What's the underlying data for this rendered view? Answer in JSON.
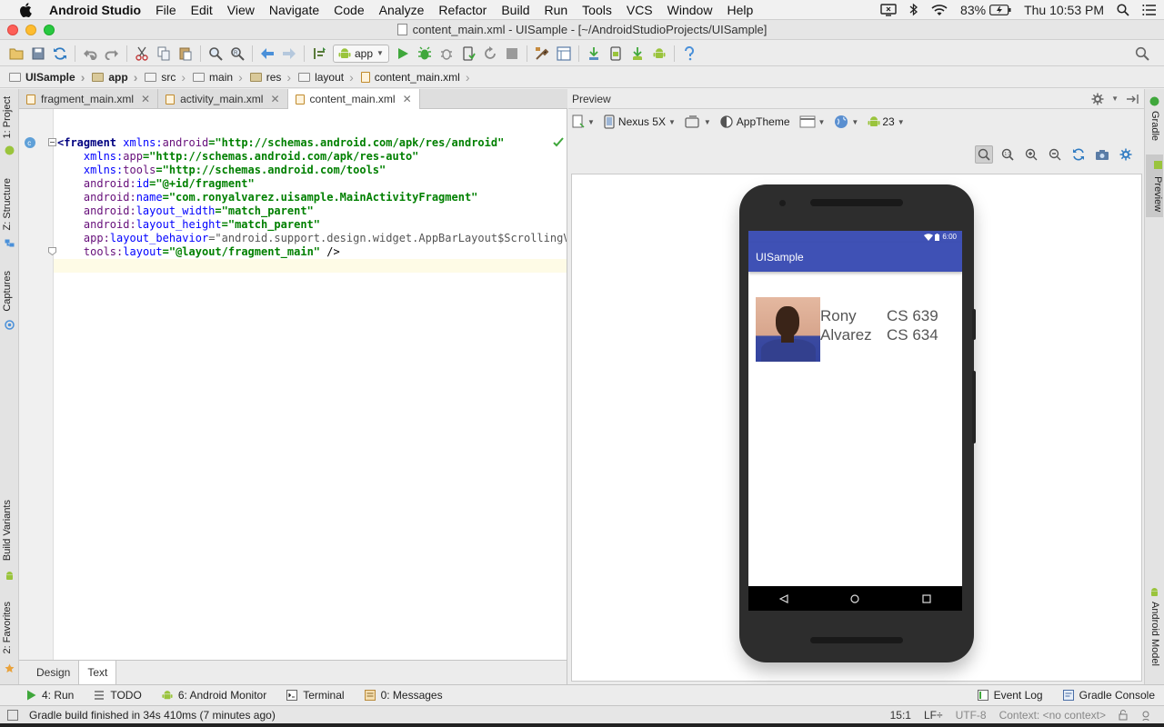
{
  "menubar": {
    "app_name": "Android Studio",
    "items": [
      "File",
      "Edit",
      "View",
      "Navigate",
      "Code",
      "Analyze",
      "Refactor",
      "Build",
      "Run",
      "Tools",
      "VCS",
      "Window",
      "Help"
    ],
    "battery": "83%",
    "clock": "Thu 10:53 PM"
  },
  "window": {
    "title": "content_main.xml - UISample - [~/AndroidStudioProjects/UISample]"
  },
  "toolbar": {
    "run_config": "app"
  },
  "breadcrumb": [
    "UISample",
    "app",
    "src",
    "main",
    "res",
    "layout",
    "content_main.xml"
  ],
  "left_tools": {
    "project": "1: Project",
    "structure": "Z: Structure",
    "captures": "Captures",
    "build_variants": "Build Variants",
    "favorites": "2: Favorites"
  },
  "right_tools": {
    "gradle": "Gradle",
    "preview": "Preview",
    "android_model": "Android Model"
  },
  "editor": {
    "tabs": [
      {
        "label": "fragment_main.xml"
      },
      {
        "label": "activity_main.xml"
      },
      {
        "label": "content_main.xml"
      }
    ],
    "lines": [
      {
        "tag": "<fragment",
        "attr_ns": "xmlns:",
        "attr": "android",
        "val": "=\"http://schemas.android.com/apk/res/android\""
      },
      {
        "attr_ns": "xmlns:",
        "attr": "app",
        "val": "=\"http://schemas.android.com/apk/res-auto\""
      },
      {
        "attr_ns": "xmlns:",
        "attr": "tools",
        "val": "=\"http://schemas.android.com/tools\""
      },
      {
        "attr_ns": "android:",
        "attr": "id",
        "val": "=\"@+id/fragment\""
      },
      {
        "attr_ns": "android:",
        "attr": "name",
        "val": "=\"com.ronyalvarez.uisample.MainActivityFragment\""
      },
      {
        "attr_ns": "android:",
        "attr": "layout_width",
        "val": "=\"match_parent\""
      },
      {
        "attr_ns": "android:",
        "attr": "layout_height",
        "val": "=\"match_parent\""
      },
      {
        "attr_ns": "app:",
        "attr": "layout_behavior",
        "val": "=\"android.support.design.widget.AppBarLayout$ScrollingVie"
      },
      {
        "attr_ns": "tools:",
        "attr": "layout",
        "val": "=\"@layout/fragment_main\"",
        "close": " />"
      }
    ],
    "bottom_tabs": [
      "Design",
      "Text"
    ]
  },
  "preview": {
    "title": "Preview",
    "device": "Nexus 5X",
    "theme": "AppTheme",
    "api": "23",
    "phone": {
      "status_time": "6:00",
      "app_title": "UISample",
      "first_name": "Rony",
      "last_name": "Alvarez",
      "course1": "CS 639",
      "course2": "CS 634"
    }
  },
  "tool_windows": {
    "run": "4: Run",
    "todo": "TODO",
    "android_monitor": "6: Android Monitor",
    "terminal": "Terminal",
    "messages": "0: Messages",
    "event_log": "Event Log",
    "gradle_console": "Gradle Console"
  },
  "statusbar": {
    "message": "Gradle build finished in 34s 410ms (7 minutes ago)",
    "position": "15:1",
    "line_sep": "LF÷",
    "encoding": "UTF-8",
    "context": "Context: <no context>"
  },
  "colors": {
    "android_green": "#9ac43c",
    "primary": "#3f51b5",
    "run_green": "#3fa73b"
  }
}
